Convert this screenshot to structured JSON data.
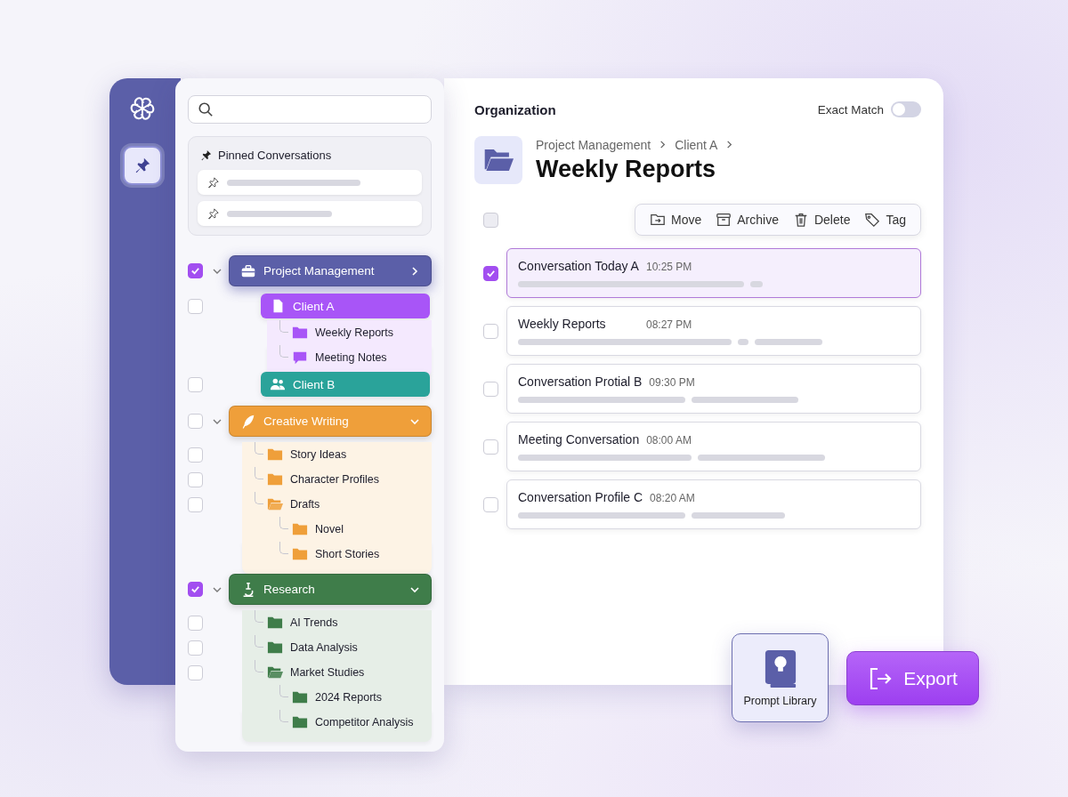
{
  "rail": {
    "pin_button": {
      "selected": true
    }
  },
  "sidebar": {
    "pinned": {
      "title": "Pinned Conversations"
    },
    "groups": [
      {
        "label": "Project Management",
        "color": "#5b5fa8",
        "checked": true,
        "expanded": true,
        "selected": true,
        "children": [
          {
            "label": "Client A",
            "kind": "tag",
            "color": "#a855f7",
            "checked": false,
            "children": [
              {
                "label": "Weekly Reports",
                "kind": "folder"
              },
              {
                "label": "Meeting Notes",
                "kind": "chat"
              }
            ]
          },
          {
            "label": "Client B",
            "kind": "tag",
            "color": "#2aa39a",
            "checked": false
          }
        ]
      },
      {
        "label": "Creative Writing",
        "color": "#ef9f3a",
        "checked": false,
        "expanded": true,
        "selected": false,
        "children": [
          {
            "label": "Story Ideas",
            "kind": "folder",
            "checked": false
          },
          {
            "label": "Character Profiles",
            "kind": "folder",
            "checked": false
          },
          {
            "label": "Drafts",
            "kind": "folder",
            "checked": false,
            "children": [
              {
                "label": "Novel",
                "kind": "folder"
              },
              {
                "label": "Short Stories",
                "kind": "folder"
              }
            ]
          }
        ]
      },
      {
        "label": "Research",
        "color": "#3f7d4a",
        "checked": true,
        "expanded": true,
        "selected": false,
        "children": [
          {
            "label": "AI Trends",
            "kind": "folder",
            "checked": false
          },
          {
            "label": "Data Analysis",
            "kind": "folder",
            "checked": false
          },
          {
            "label": "Market Studies",
            "kind": "folder",
            "checked": false,
            "children": [
              {
                "label": "2024 Reports",
                "kind": "folder"
              },
              {
                "label": "Competitor Analysis",
                "kind": "folder"
              }
            ]
          }
        ]
      }
    ]
  },
  "main": {
    "heading": "Organization",
    "exact_match": {
      "label": "Exact Match",
      "on": false
    },
    "breadcrumb": [
      "Project Management",
      "Client A"
    ],
    "title": "Weekly Reports",
    "select_all": {
      "checked": false
    },
    "actions": [
      "Move",
      "Archive",
      "Delete",
      "Tag"
    ],
    "conversations": [
      {
        "title": "Conversation Today A",
        "time": "10:25 PM",
        "checked": true
      },
      {
        "title": "Weekly Reports",
        "time": "08:27 PM",
        "checked": false
      },
      {
        "title": "Conversation Protial B",
        "time": "09:30 PM",
        "checked": false
      },
      {
        "title": "Meeting Conversation",
        "time": "08:00 AM",
        "checked": false
      },
      {
        "title": "Conversation Profile C",
        "time": "08:20 AM",
        "checked": false
      }
    ]
  },
  "floating": {
    "prompt_library": "Prompt Library",
    "export": "Export"
  }
}
